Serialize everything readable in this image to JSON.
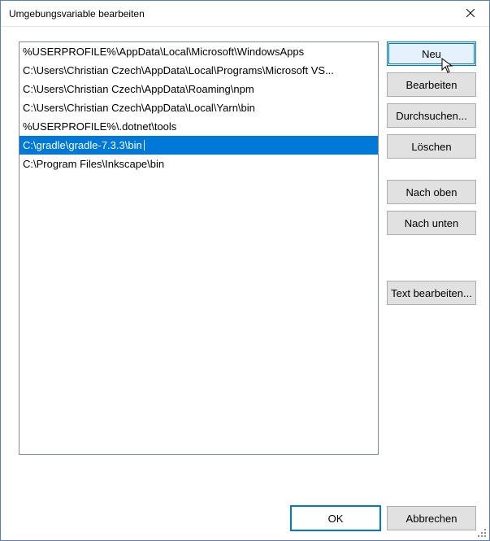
{
  "window": {
    "title": "Umgebungsvariable bearbeiten"
  },
  "list": {
    "items": [
      {
        "value": "%USERPROFILE%\\AppData\\Local\\Microsoft\\WindowsApps",
        "selected": false
      },
      {
        "value": "C:\\Users\\Christian Czech\\AppData\\Local\\Programs\\Microsoft VS...",
        "selected": false
      },
      {
        "value": "C:\\Users\\Christian Czech\\AppData\\Roaming\\npm",
        "selected": false
      },
      {
        "value": "C:\\Users\\Christian Czech\\AppData\\Local\\Yarn\\bin",
        "selected": false
      },
      {
        "value": "%USERPROFILE%\\.dotnet\\tools",
        "selected": false
      },
      {
        "value": "C:\\gradle\\gradle-7.3.3\\bin",
        "selected": true
      },
      {
        "value": "C:\\Program Files\\Inkscape\\bin",
        "selected": false
      }
    ]
  },
  "buttons": {
    "new": "Neu",
    "edit": "Bearbeiten",
    "browse": "Durchsuchen...",
    "delete": "Löschen",
    "moveUp": "Nach oben",
    "moveDown": "Nach unten",
    "editText": "Text bearbeiten..."
  },
  "footer": {
    "ok": "OK",
    "cancel": "Abbrechen"
  }
}
